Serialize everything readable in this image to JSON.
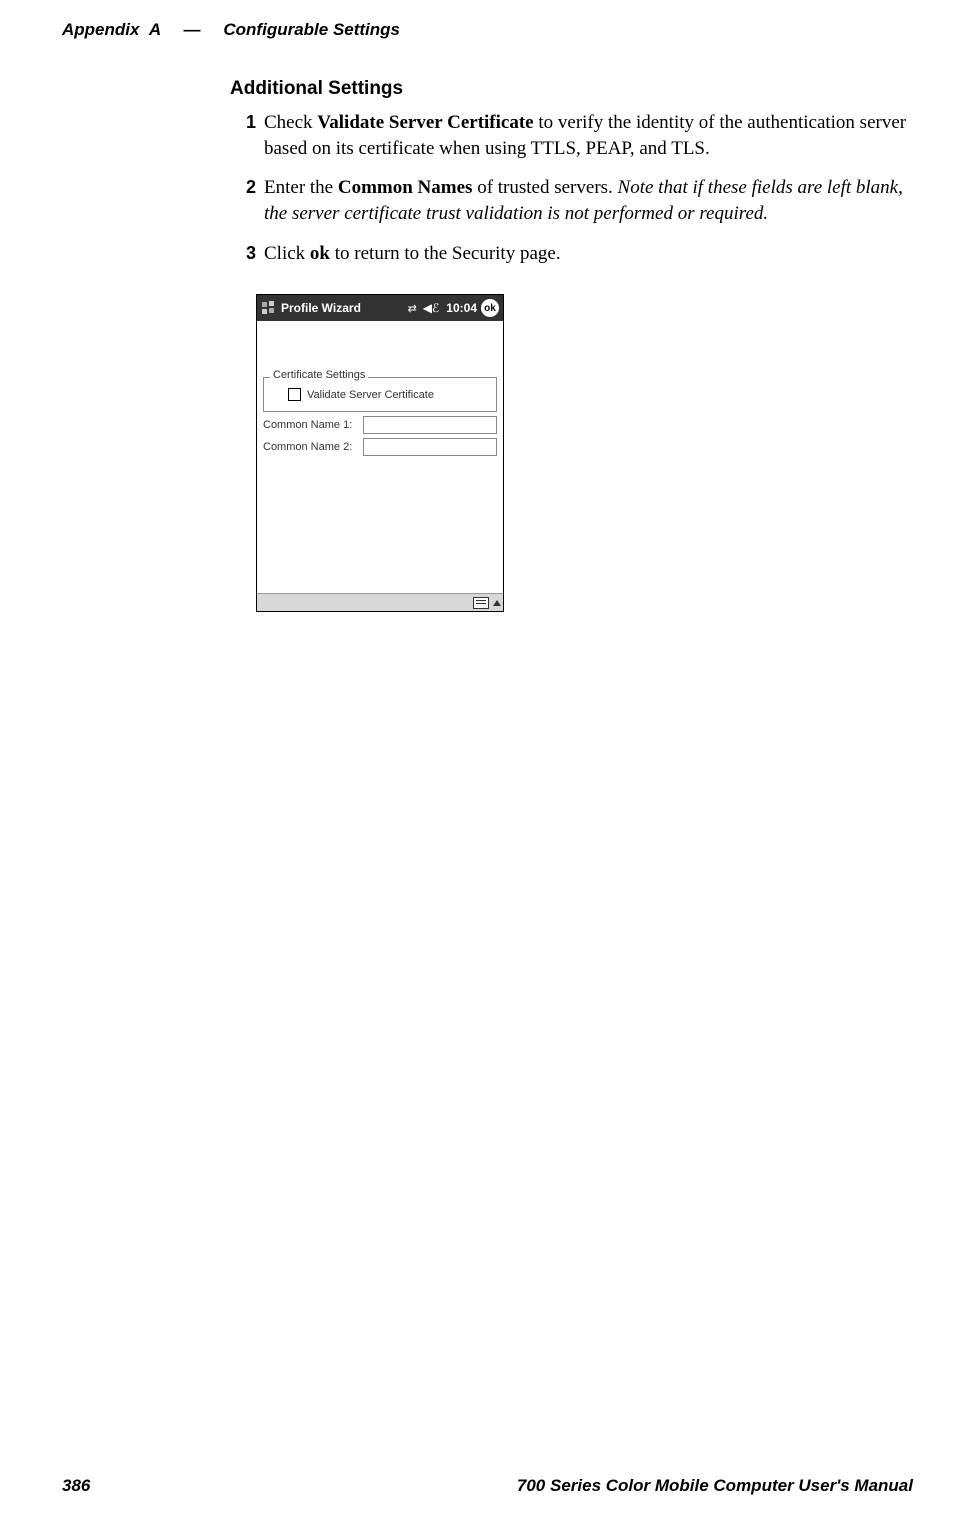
{
  "header": {
    "appendix": "Appendix",
    "appendix_letter": "A",
    "dash": "—",
    "section": "Configurable Settings"
  },
  "content": {
    "section_title": "Additional Settings",
    "steps": {
      "s1": {
        "num": "1",
        "pre": "Check ",
        "bold": "Validate Server Certificate",
        "post": " to verify the identity of the authentication server based on its certificate when using TTLS, PEAP, and TLS."
      },
      "s2": {
        "num": "2",
        "pre": "Enter the ",
        "bold": "Common Names",
        "mid": " of trusted servers. ",
        "italic": "Note that if these fields are left blank, the server certificate trust validation is not performed or required."
      },
      "s3": {
        "num": "3",
        "pre": "Click ",
        "bold": "ok",
        "post": " to return to the Security page."
      }
    }
  },
  "screenshot": {
    "titlebar": {
      "title": "Profile Wizard",
      "time": "10:04",
      "ok": "ok"
    },
    "fieldset_legend": "Certificate Settings",
    "checkbox_label": "Validate Server Certificate",
    "name1_label": "Common Name 1:",
    "name2_label": "Common Name 2:",
    "name1_value": "",
    "name2_value": ""
  },
  "footer": {
    "page_number": "386",
    "manual_title": "700 Series Color Mobile Computer User's Manual"
  }
}
